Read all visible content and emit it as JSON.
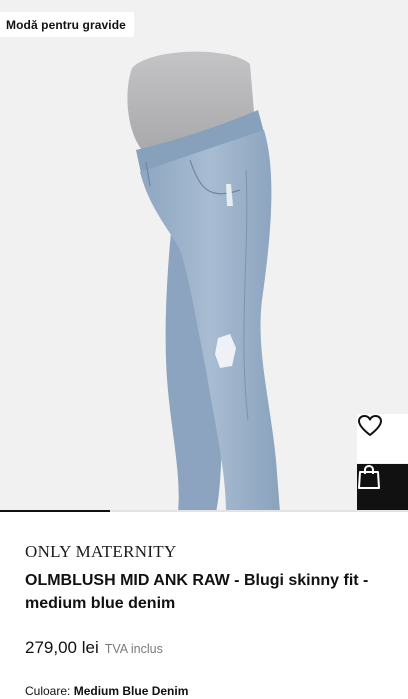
{
  "badge": {
    "label": "Modă pentru gravide"
  },
  "product": {
    "brand": "ONLY MATERNITY",
    "title": "OLMBLUSH MID ANK RAW  - Blugi skinny fit - medium blue denim",
    "price": "279,00 lei",
    "vat_note": "TVA inclus",
    "color_label": "Culoare:",
    "color_value": "Medium Blue Denim"
  },
  "gallery": {
    "progress": 0.27
  },
  "icons": {
    "wishlist": "heart-icon",
    "cart": "shopping-bag-icon"
  },
  "colors": {
    "accent": "#111111",
    "background": "#f1f1f1",
    "denim": "#9db3cc"
  }
}
